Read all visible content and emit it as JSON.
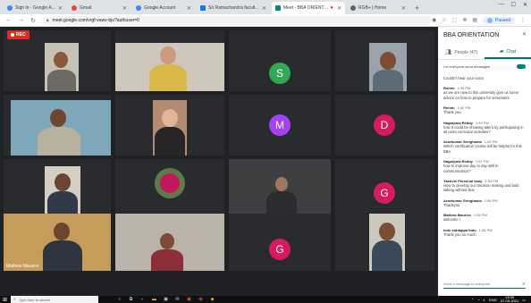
{
  "browser": {
    "tabs": [
      {
        "title": "Sign In - Google Accounts",
        "color": "#4285f4",
        "active": false
      },
      {
        "title": "Gmail",
        "color": "#ea4335",
        "active": false
      },
      {
        "title": "Google Account",
        "color": "#4285f4",
        "active": false
      },
      {
        "title": "Sri Ramachandra faculty of Engi...",
        "color": "#1a73e8",
        "active": false
      },
      {
        "title": "Meet - BBA ORIENTATION",
        "color": "#00897b",
        "active": true
      },
      {
        "title": "RGB+ | Home",
        "color": "#5f6368",
        "active": false
      }
    ],
    "url": "meet.google.com/vrgf-vawv-bju?authuser=0",
    "profile_label": "Paused"
  },
  "meeting": {
    "rec_label": "REC",
    "tiles": [
      {
        "type": "photo",
        "name": ""
      },
      {
        "type": "photo",
        "name": ""
      },
      {
        "type": "avatar",
        "letter": "S",
        "color": "#33a852"
      },
      {
        "type": "photo",
        "name": ""
      },
      {
        "type": "photo",
        "name": ""
      },
      {
        "type": "photo",
        "name": ""
      },
      {
        "type": "avatar",
        "letter": "M",
        "color": "#a142f4"
      },
      {
        "type": "avatar",
        "letter": "D",
        "color": "#d81b60"
      },
      {
        "type": "photo",
        "name": ""
      },
      {
        "type": "photo",
        "name": ""
      },
      {
        "type": "photo",
        "name": ""
      },
      {
        "type": "avatar",
        "letter": "G",
        "color": "#d81b60"
      },
      {
        "type": "photo",
        "name": "Mathew Maurice"
      },
      {
        "type": "photo",
        "name": ""
      },
      {
        "type": "avatar",
        "letter": "G",
        "color": "#d81b60"
      },
      {
        "type": "photo",
        "name": ""
      }
    ]
  },
  "panel": {
    "title": "BBA ORIENTATION",
    "people_tab": "People (47)",
    "chat_tab": "Chat",
    "toggle_label": "Let everyone send messages",
    "messages": [
      {
        "sender": "",
        "time": "",
        "text": "Couldn't hear your voice"
      },
      {
        "sender": "Rohini",
        "time": "1:49 PM",
        "text": "as we are new to this university give us some advice on how to prepare for semesters."
      },
      {
        "sender": "Rohini",
        "time": "1:52 PM",
        "text": "Thank you."
      },
      {
        "sender": "Nagarjuna Reddy",
        "time": "1:49 PM",
        "text": "how it could be showing talent by participating in all extra curricular activities?"
      },
      {
        "sender": "Aravkumar Sringhania",
        "time": "1:49 PM",
        "text": "Which certification course will be helpful for this BBA"
      },
      {
        "sender": "Nagarjuna Reddy",
        "time": "1:51 PM",
        "text": "how to improve day to day skill in communication?"
      },
      {
        "sender": "Yashvin Personal sany",
        "time": "1:54 PM",
        "text": "How to develop our decision making and bold talking without fear"
      },
      {
        "sender": "Aravkumar Sringhania",
        "time": "1:56 PM",
        "text": "Thankyou"
      },
      {
        "sender": "Mathew Maurice",
        "time": "1:56 PM",
        "text": "welcome !"
      },
      {
        "sender": "Indu siddappa Indu",
        "time": "1:58 PM",
        "text": "Thank you so much"
      }
    ],
    "input_placeholder": "Send a message to everyone"
  },
  "taskbar": {
    "search_placeholder": "Type here to search",
    "lang": "ENG",
    "time": "13:59",
    "date": "07-09-2021"
  }
}
